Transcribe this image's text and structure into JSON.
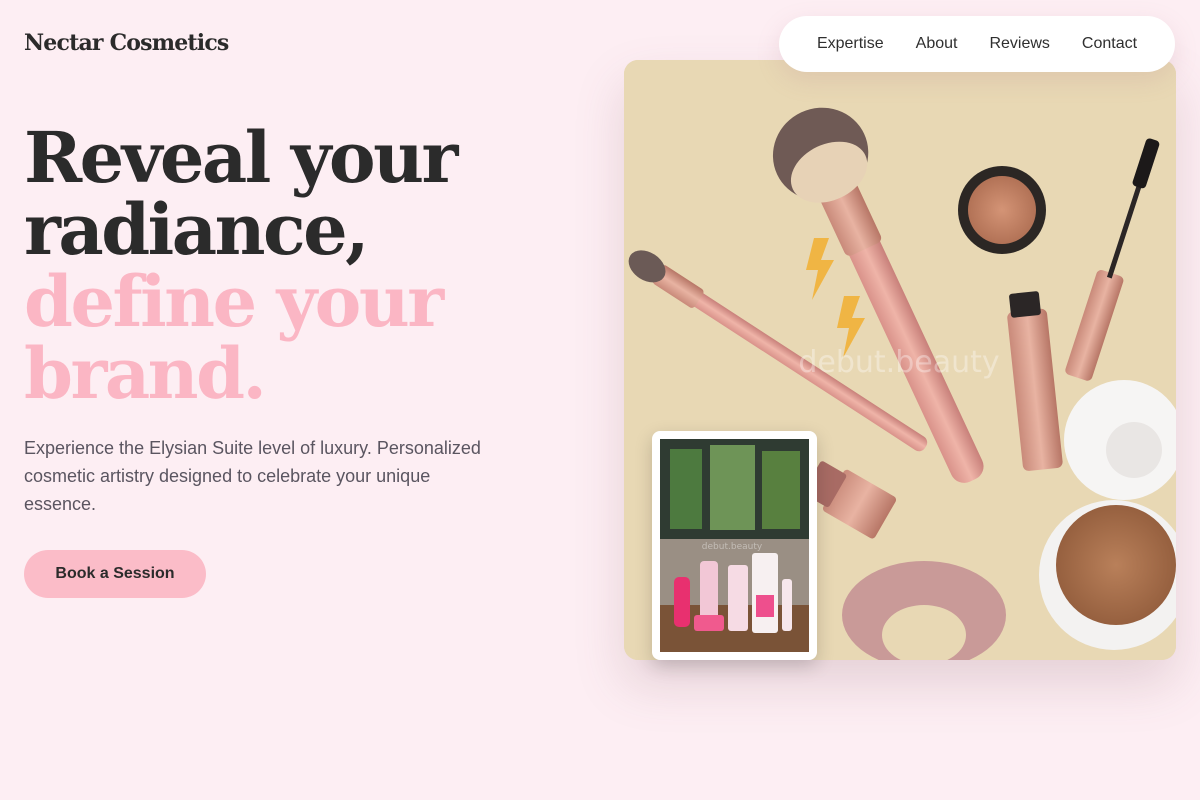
{
  "brand": {
    "logo_text": "Nectar Cosmetics"
  },
  "nav": {
    "items": [
      {
        "label": "Expertise"
      },
      {
        "label": "About"
      },
      {
        "label": "Reviews"
      },
      {
        "label": "Contact"
      }
    ]
  },
  "hero": {
    "headline_line1": "Reveal your",
    "headline_line2": "radiance,",
    "headline_line3": "define your",
    "headline_line4": "brand.",
    "description": "Experience the Elysian Suite level of luxury. Personalized cosmetic artistry designed to celebrate your unique essence.",
    "cta_label": "Book a Session"
  },
  "images": {
    "main_watermark": "debut.beauty",
    "thumb_watermark": "debut.beauty"
  },
  "colors": {
    "background": "#fdeef3",
    "accent_pink": "#fbb6c4",
    "button_pink": "#fbbcc8",
    "text_dark": "#2b2b2b",
    "text_body": "#5a5560"
  },
  "icons": [
    "makeup-brush",
    "mascara",
    "lipstick",
    "compact-powder",
    "blush-pot",
    "scrunchie",
    "lightning-earring"
  ]
}
